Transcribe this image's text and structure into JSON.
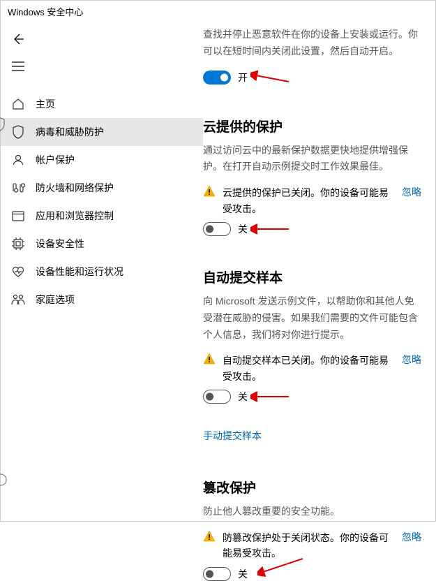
{
  "window": {
    "title": "Windows 安全中心"
  },
  "sidebar": {
    "items": [
      {
        "label": "主页"
      },
      {
        "label": "病毒和威胁防护"
      },
      {
        "label": "帐户保护"
      },
      {
        "label": "防火墙和网络保护"
      },
      {
        "label": "应用和浏览器控制"
      },
      {
        "label": "设备安全性"
      },
      {
        "label": "设备性能和运行状况"
      },
      {
        "label": "家庭选项"
      }
    ]
  },
  "sections": {
    "realtime": {
      "desc": "查找并停止恶意软件在你的设备上安装或运行。你可以在短时间内关闭此设置，然后自动开启。",
      "state": "开"
    },
    "cloud": {
      "title": "云提供的保护",
      "desc": "通过访问云中的最新保护数据更快地提供增强保护。在打开自动示例提交时工作效果最佳。",
      "warning": "云提供的保护已关闭。你的设备可能易受攻击。",
      "dismiss": "忽略",
      "state": "关"
    },
    "sample": {
      "title": "自动提交样本",
      "desc": "向 Microsoft 发送示例文件，以帮助你和其他人免受潜在威胁的侵害。如果我们需要的文件可能包含个人信息，我们将对你进行提示。",
      "warning": "自动提交样本已关闭。你的设备可能易受攻击。",
      "dismiss": "忽略",
      "state": "关",
      "manual": "手动提交样本"
    },
    "tamper": {
      "title": "篡改保护",
      "desc": "防止他人篡改重要的安全功能。",
      "warning": "防篡改保护处于关闭状态。你的设备可能易受攻击。",
      "dismiss": "忽略",
      "state": "关"
    }
  }
}
